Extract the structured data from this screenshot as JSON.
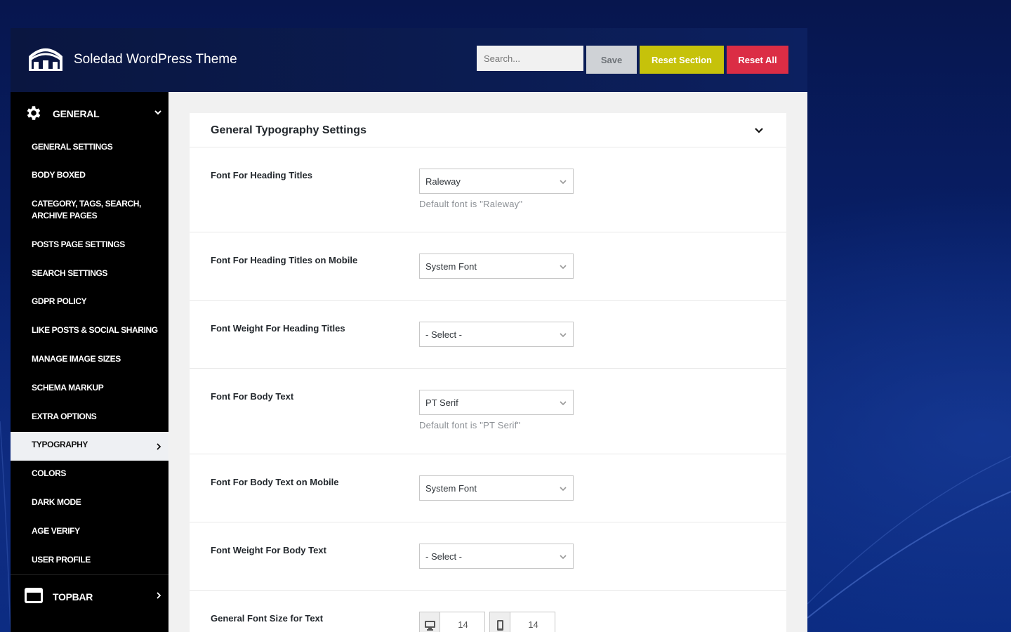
{
  "app": {
    "title": "Soledad WordPress Theme"
  },
  "toolbar": {
    "search_placeholder": "Search...",
    "save_label": "Save",
    "reset_section_label": "Reset Section",
    "reset_all_label": "Reset All"
  },
  "sidebar": {
    "general": {
      "label": "GENERAL",
      "icon": "gear-icon"
    },
    "items": [
      {
        "label": "GENERAL SETTINGS"
      },
      {
        "label": "BODY BOXED"
      },
      {
        "label": "CATEGORY, TAGS, SEARCH, ARCHIVE PAGES"
      },
      {
        "label": "POSTS PAGE SETTINGS"
      },
      {
        "label": "SEARCH SETTINGS"
      },
      {
        "label": "GDPR POLICY"
      },
      {
        "label": "LIKE POSTS & SOCIAL SHARING"
      },
      {
        "label": "MANAGE IMAGE SIZES"
      },
      {
        "label": "SCHEMA MARKUP"
      },
      {
        "label": "EXTRA OPTIONS"
      },
      {
        "label": "TYPOGRAPHY",
        "active": true
      },
      {
        "label": "COLORS"
      },
      {
        "label": "DARK MODE"
      },
      {
        "label": "AGE VERIFY"
      },
      {
        "label": "USER PROFILE"
      }
    ],
    "topbar": {
      "label": "TOPBAR",
      "icon": "window-icon"
    }
  },
  "panel": {
    "title": "General Typography Settings",
    "fields": [
      {
        "label": "Font For Heading Titles",
        "value": "Raleway",
        "hint": "Default font is \"Raleway\""
      },
      {
        "label": "Font For Heading Titles on Mobile",
        "value": "System Font"
      },
      {
        "label": "Font Weight For Heading Titles",
        "value": "- Select -"
      },
      {
        "label": "Font For Body Text",
        "value": "PT Serif",
        "hint": "Default font is \"PT Serif\""
      },
      {
        "label": "Font For Body Text on Mobile",
        "value": "System Font"
      },
      {
        "label": "Font Weight For Body Text",
        "value": "- Select -"
      }
    ],
    "font_size": {
      "label": "General Font Size for Text",
      "desktop": "14",
      "mobile": "14"
    }
  },
  "colors": {
    "save": "#cfd2d6",
    "reset_section": "#c6c20a",
    "reset_all": "#db2d45",
    "sidebar_bg": "#000000"
  }
}
